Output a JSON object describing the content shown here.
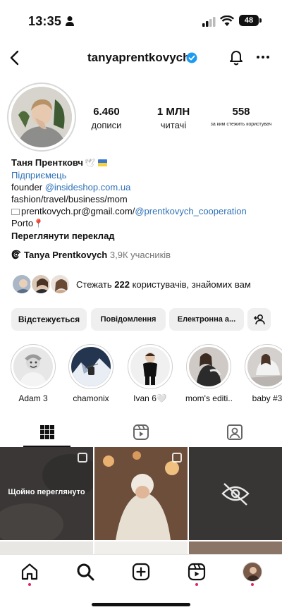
{
  "status_bar": {
    "time": "13:35",
    "battery": "48"
  },
  "header": {
    "username": "tanyaprentkovych"
  },
  "stats": {
    "posts": {
      "value": "6.460",
      "label": "дописи"
    },
    "followers": {
      "value": "1 МЛН",
      "label": "читачі"
    },
    "following": {
      "value": "558",
      "label": "за ким стежить користувач"
    }
  },
  "bio": {
    "name": "Таня Прентковч",
    "category": "Підприємець",
    "line1_prefix": "founder ",
    "line1_link": "@insideshop.com.ua",
    "line2": "fashion/travel/business/mom",
    "email": "prentkovych.pr@gmail.com/",
    "email_link": "@prentkovych_cooperation",
    "location": "Porto",
    "translate": "Переглянути переклад"
  },
  "threads": {
    "name": "Tanya Prentkovych",
    "count": "3,9К учасників"
  },
  "followed_by": {
    "prefix": "Стежать ",
    "count": "222",
    "suffix": " користувачів, знайомих вам"
  },
  "buttons": {
    "following": "Відстежується",
    "message": "Повідомлення",
    "email": "Електронна а..."
  },
  "highlights": [
    {
      "label": "Adam 3"
    },
    {
      "label": "chamonix"
    },
    {
      "label": "Ivan 6🤍"
    },
    {
      "label": "mom's editi..."
    },
    {
      "label": "baby #3"
    }
  ],
  "grid": {
    "seen_label": "Щойно переглянуто"
  },
  "icons": {
    "back": "chevron-left-icon",
    "verified": "verified-badge-icon",
    "bell": "bell-icon",
    "more": "more-horizontal-icon",
    "threads": "threads-icon",
    "add_user": "add-user-icon",
    "grid_tab": "grid-icon",
    "reels_tab": "reels-icon",
    "tagged_tab": "tagged-icon",
    "home": "home-icon",
    "search": "search-icon",
    "create": "create-icon",
    "reels": "reels-icon",
    "profile": "profile-avatar"
  },
  "colors": {
    "link": "#2f72b8",
    "verified": "#1d9bf0",
    "notification_dot": "#e0245e"
  }
}
